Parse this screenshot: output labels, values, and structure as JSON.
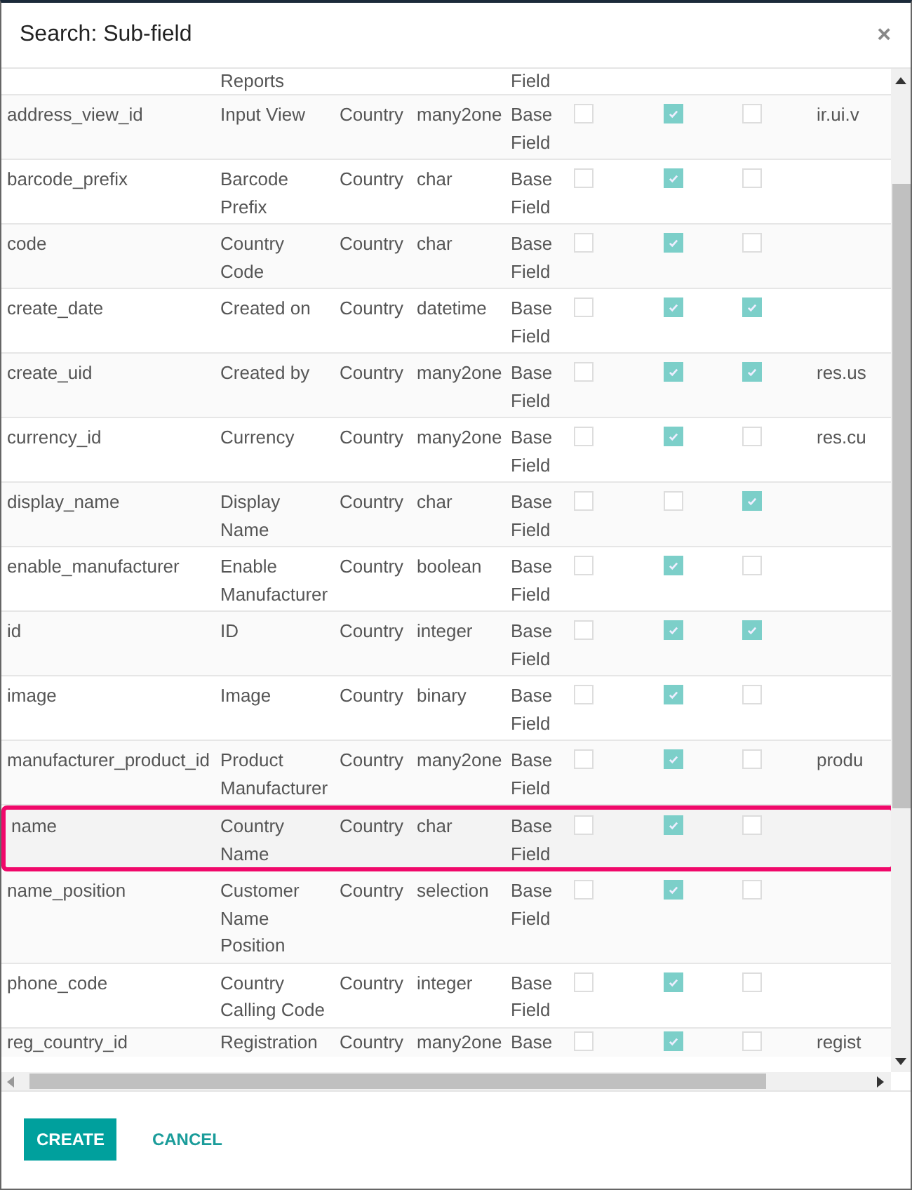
{
  "dialog": {
    "title": "Search: Sub-field",
    "close": "×"
  },
  "table": {
    "rows": [
      {
        "cells": [
          "",
          "Reports",
          "",
          "",
          "Field",
          ""
        ],
        "checks": [],
        "highlighted": false
      },
      {
        "cells": [
          "address_view_id",
          "Input View",
          "Country",
          "many2one",
          "Base Field",
          "ir.ui.v"
        ],
        "checks": [
          false,
          true,
          false
        ],
        "highlighted": false
      },
      {
        "cells": [
          "barcode_prefix",
          "Barcode Prefix",
          "Country",
          "char",
          "Base Field",
          ""
        ],
        "checks": [
          false,
          true,
          false
        ],
        "highlighted": false
      },
      {
        "cells": [
          "code",
          "Country Code",
          "Country",
          "char",
          "Base Field",
          ""
        ],
        "checks": [
          false,
          true,
          false
        ],
        "highlighted": false
      },
      {
        "cells": [
          "create_date",
          "Created on",
          "Country",
          "datetime",
          "Base Field",
          ""
        ],
        "checks": [
          false,
          true,
          true
        ],
        "highlighted": false
      },
      {
        "cells": [
          "create_uid",
          "Created by",
          "Country",
          "many2one",
          "Base Field",
          "res.us"
        ],
        "checks": [
          false,
          true,
          true
        ],
        "highlighted": false
      },
      {
        "cells": [
          "currency_id",
          "Currency",
          "Country",
          "many2one",
          "Base Field",
          "res.cu"
        ],
        "checks": [
          false,
          true,
          false
        ],
        "highlighted": false
      },
      {
        "cells": [
          "display_name",
          "Display Name",
          "Country",
          "char",
          "Base Field",
          ""
        ],
        "checks": [
          false,
          false,
          true
        ],
        "highlighted": false
      },
      {
        "cells": [
          "enable_manufacturer",
          "Enable Manufacturer",
          "Country",
          "boolean",
          "Base Field",
          ""
        ],
        "checks": [
          false,
          true,
          false
        ],
        "highlighted": false
      },
      {
        "cells": [
          "id",
          "ID",
          "Country",
          "integer",
          "Base Field",
          ""
        ],
        "checks": [
          false,
          true,
          true
        ],
        "highlighted": false
      },
      {
        "cells": [
          "image",
          "Image",
          "Country",
          "binary",
          "Base Field",
          ""
        ],
        "checks": [
          false,
          true,
          false
        ],
        "highlighted": false
      },
      {
        "cells": [
          "manufacturer_product_id",
          "Product Manufacturer",
          "Country",
          "many2one",
          "Base Field",
          "produ"
        ],
        "checks": [
          false,
          true,
          false
        ],
        "highlighted": false
      },
      {
        "cells": [
          "name",
          "Country Name",
          "Country",
          "char",
          "Base Field",
          ""
        ],
        "checks": [
          false,
          true,
          false
        ],
        "highlighted": true
      },
      {
        "cells": [
          "name_position",
          "Customer Name Position",
          "Country",
          "selection",
          "Base Field",
          ""
        ],
        "checks": [
          false,
          true,
          false
        ],
        "highlighted": false
      },
      {
        "cells": [
          "phone_code",
          "Country Calling Code",
          "Country",
          "integer",
          "Base Field",
          ""
        ],
        "checks": [
          false,
          true,
          false
        ],
        "highlighted": false
      },
      {
        "cells": [
          "reg_country_id",
          "Registration",
          "Country",
          "many2one",
          "Base",
          "regist"
        ],
        "checks": [
          false,
          true,
          false
        ],
        "highlighted": false
      }
    ]
  },
  "buttons": [
    {
      "label": "CREATE",
      "kind": "primary"
    },
    {
      "label": "CANCEL",
      "kind": "link"
    }
  ]
}
